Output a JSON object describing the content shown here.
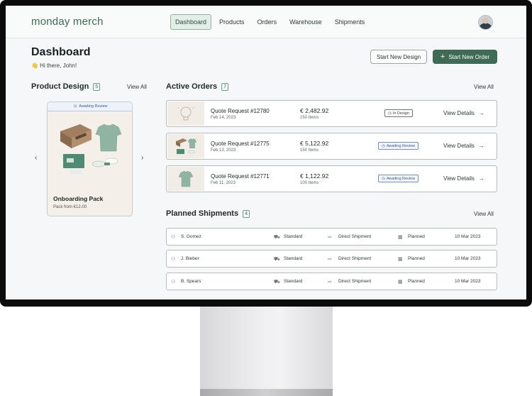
{
  "app": {
    "logo": "monday merch"
  },
  "nav": {
    "items": [
      "Dashboard",
      "Products",
      "Orders",
      "Warehouse",
      "Shipments"
    ]
  },
  "header": {
    "title": "Dashboard",
    "greeting": "👋 Hi there, John!",
    "start_design_label": "Start New Design",
    "start_order_label": "Start New Order"
  },
  "product_design": {
    "title": "Product Design",
    "count": "5",
    "view_all": "View All",
    "card": {
      "status": "Awaiting Review",
      "name": "Onboarding Pack",
      "price": "Pack from €12.00"
    }
  },
  "active_orders": {
    "title": "Active Orders",
    "count": "7",
    "view_all": "View All",
    "orders": [
      {
        "title": "Quote Request #12780",
        "date": "Feb 14, 2023",
        "amount": "€ 2,482.92",
        "items": "150 Items",
        "status": "In Design",
        "action": "View Details"
      },
      {
        "title": "Quote Request #12775",
        "date": "Feb 13, 2023",
        "amount": "€ 5,122.92",
        "items": "150 Items",
        "status": "Awaiting Review",
        "action": "View Details"
      },
      {
        "title": "Quote Request #12771",
        "date": "Feb 11, 2023",
        "amount": "€ 1,122.92",
        "items": "100 Items",
        "status": "Awaiting Review",
        "action": "View Details"
      }
    ]
  },
  "planned_shipments": {
    "title": "Planned Shipments",
    "count": "4",
    "view_all": "View All",
    "rows": [
      {
        "name": "S. Gomez",
        "method": "Standard",
        "type": "Direct Shipment",
        "status": "Planned",
        "date": "10 Mar 2023"
      },
      {
        "name": "J. Bieber",
        "method": "Standard",
        "type": "Direct Shipment",
        "status": "Planned",
        "date": "10 Mar 2023"
      },
      {
        "name": "B. Spears",
        "method": "Standard",
        "type": "Direct Shipment",
        "status": "Planned",
        "date": "10 Mar 2023"
      }
    ]
  },
  "colors": {
    "brand": "#3f6b56",
    "review_blue": "#36579b",
    "border": "#b7bdbb"
  }
}
